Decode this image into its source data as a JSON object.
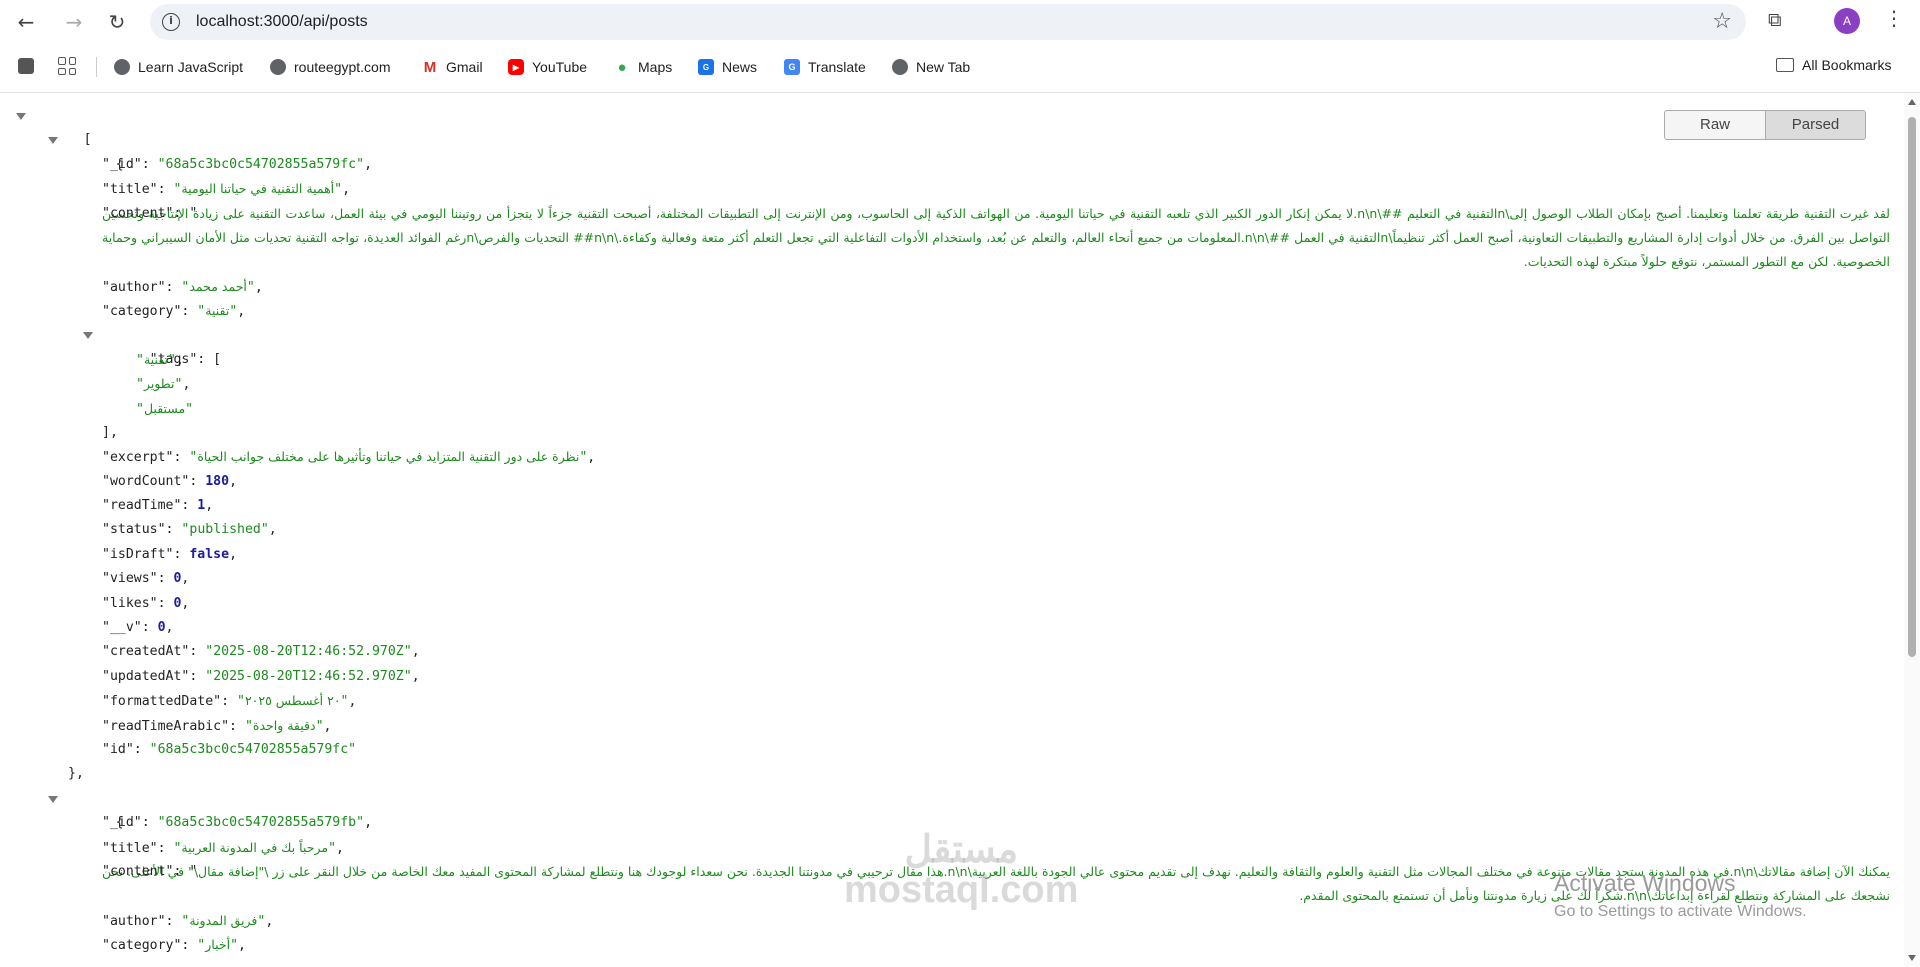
{
  "browser": {
    "url": "localhost:3000/api/posts",
    "avatar_letter": "A"
  },
  "bookmarks": [
    {
      "label": "Learn JavaScript",
      "icon": "globe-icon"
    },
    {
      "label": "routeegypt.com",
      "icon": "globe-icon"
    },
    {
      "label": "Gmail",
      "icon": "gmail-icon"
    },
    {
      "label": "YouTube",
      "icon": "youtube-icon"
    },
    {
      "label": "Maps",
      "icon": "maps-icon"
    },
    {
      "label": "News",
      "icon": "news-icon"
    },
    {
      "label": "Translate",
      "icon": "translate-icon"
    },
    {
      "label": "New Tab",
      "icon": "globe-icon"
    }
  ],
  "all_bookmarks": "All Bookmarks",
  "toggle": {
    "raw": "Raw",
    "parsed": "Parsed"
  },
  "posts": [
    {
      "_id": "68a5c3bc0c54702855a579fc",
      "title": "أهمية التقنية في حياتنا اليومية",
      "content": "لقد غيرت التقنية طريقة تعلمنا وتعليمنا. أصبح بإمكان الطلاب الوصول إلى\\nالتقنية في التعليم ##\\n\\n.لا يمكن إنكار الدور الكبير الذي تلعبه التقنية في حياتنا اليومية. من الهواتف الذكية إلى الحاسوب، ومن الإنترنت إلى التطبيقات المختلفة، أصبحت التقنية جزءاً لا يتجزأ من روتيننا اليومي في بيئة العمل، ساعدت التقنية على زيادة الإنتاجية وتحسين التواصل بين الفرق. من خلال أدوات إدارة المشاريع والتطبيقات التعاونية، أصبح العمل أكثر تنظيماً\\nالتقنية في العمل ##\\n\\n.المعلومات من جميع أنحاء العالم، والتعلم عن بُعد، واستخدام الأدوات التفاعلية التي تجعل التعلم أكثر متعة وفعالية وكفاءة.\\n\\n## التحديات والفرص\\nرغم الفوائد العديدة، تواجه التقنية تحديات مثل الأمان السيبراني وحماية الخصوصية. لكن مع التطور المستمر، نتوقع حلولاً مبتكرة لهذه التحديات.",
      "author": "أحمد محمد",
      "category": "تقنية",
      "tags": [
        "تقنية",
        "تطوير",
        "مستقبل"
      ],
      "excerpt": "نظرة على دور التقنية المتزايد في حياتنا وتأثيرها على مختلف جوانب الحياة",
      "wordCount": "180",
      "readTime": "1",
      "status": "published",
      "isDraft": "false",
      "views": "0",
      "likes": "0",
      "__v": "0",
      "createdAt": "2025-08-20T12:46:52.970Z",
      "updatedAt": "2025-08-20T12:46:52.970Z",
      "formattedDate": "٢٠ أغسطس ٢٠٢٥",
      "readTimeArabic": "دقيقة واحدة",
      "id": "68a5c3bc0c54702855a579fc"
    },
    {
      "_id": "68a5c3bc0c54702855a579fb",
      "title": "مرحباً بك في المدونة العربية",
      "content": "يمكنك الآن إضافة مقالاتك\\n\\n.في هذه المدونة ستجد مقالات متنوعة في مختلف المجالات مثل التقنية والعلوم والثقافة والتعليم. نهدف إلى تقديم محتوى عالي الجودة باللغة العربية\\n\\n.هذا مقال ترحيبي في مدونتنا الجديدة. نحن سعداء لوجودك هنا ونتطلع لمشاركة المحتوى المفيد معك الخاصة من خلال النقر على زر \\\"إضافة مقال\\\" في الأعلى. نحن نشجعك على المشاركة ونتطلع لقراءة إبداعاتك\\n\\n.شكراً لك على زيارة مدونتنا ونأمل أن تستمتع بالمحتوى المقدم.",
      "author": "فريق المدونة",
      "category": "أخبار"
    }
  ],
  "activate_windows": {
    "title": "Activate Windows",
    "subtitle": "Go to Settings to activate Windows."
  },
  "watermark": {
    "line1": "مستقل",
    "line2": "mostaql.com"
  }
}
